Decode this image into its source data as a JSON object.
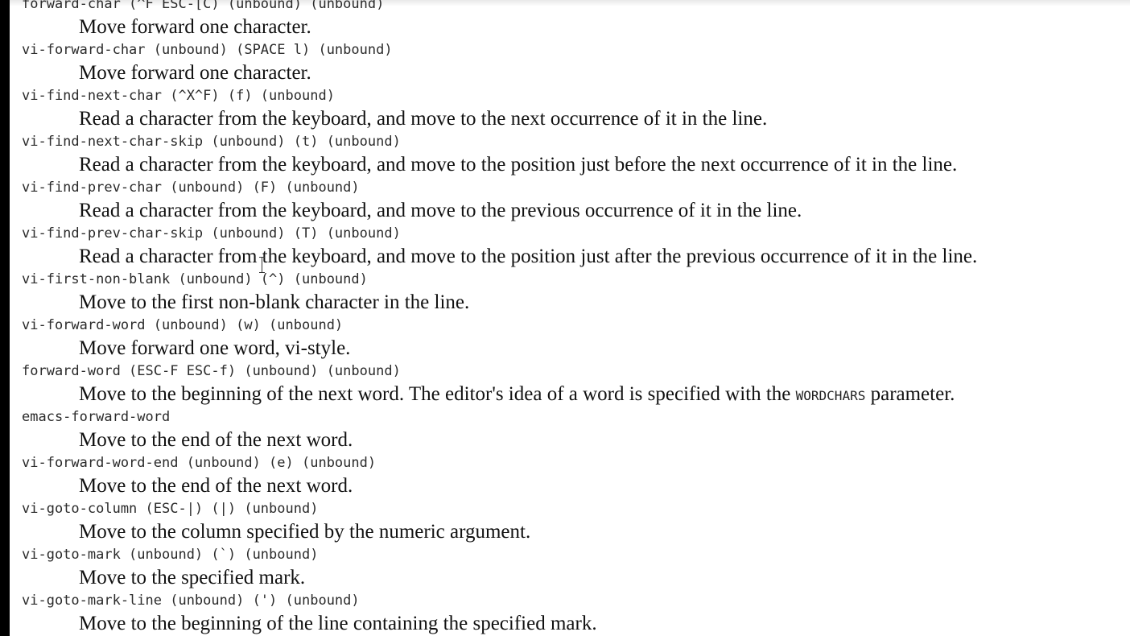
{
  "entries": [
    {
      "signature": "forward-char (^F ESC-[C) (unbound) (unbound)",
      "description": "Move forward one character."
    },
    {
      "signature": "vi-forward-char (unbound) (SPACE l) (unbound)",
      "description": "Move forward one character."
    },
    {
      "signature": "vi-find-next-char (^X^F) (f) (unbound)",
      "description": "Read a character from the keyboard, and move to the next occurrence of it in the line."
    },
    {
      "signature": "vi-find-next-char-skip (unbound) (t) (unbound)",
      "description": "Read a character from the keyboard, and move to the position just before the next occurrence of it in the line."
    },
    {
      "signature": "vi-find-prev-char (unbound) (F) (unbound)",
      "description": "Read a character from the keyboard, and move to the previous occurrence of it in the line."
    },
    {
      "signature": "vi-find-prev-char-skip (unbound) (T) (unbound)",
      "description": "Read a character from the keyboard, and move to the position just after the previous occurrence of it in the line."
    },
    {
      "signature": "vi-first-non-blank (unbound) (^) (unbound)",
      "description": "Move to the first non-blank character in the line."
    },
    {
      "signature": "vi-forward-word (unbound) (w) (unbound)",
      "description": "Move forward one word, vi-style."
    },
    {
      "signature": "forward-word (ESC-F ESC-f) (unbound) (unbound)",
      "description_before": "Move to the beginning of the next word. The editor's idea of a word is specified with the ",
      "description_param": "WORDCHARS",
      "description_after": " parameter."
    },
    {
      "signature": "emacs-forward-word",
      "description": "Move to the end of the next word."
    },
    {
      "signature": "vi-forward-word-end (unbound) (e) (unbound)",
      "description": "Move to the end of the next word."
    },
    {
      "signature": "vi-goto-column (ESC-|) (|) (unbound)",
      "description": "Move to the column specified by the numeric argument."
    },
    {
      "signature": "vi-goto-mark (unbound) (`) (unbound)",
      "description": "Move to the specified mark."
    },
    {
      "signature": "vi-goto-mark-line (unbound) (') (unbound)",
      "description": "Move to the beginning of the line containing the specified mark."
    }
  ]
}
